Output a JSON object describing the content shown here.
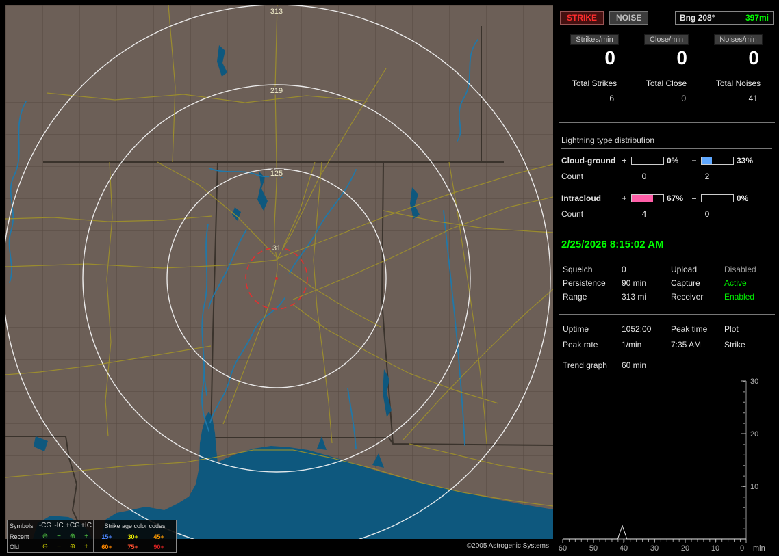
{
  "colors": {
    "accent_green": "#00ff00",
    "strike_red": "#ff2d2d",
    "bar_blue": "#5fa8ff",
    "bar_pink": "#ff5fa8",
    "map_land": "#6c5f57",
    "map_water": "#0e587e",
    "status_disabled": "#9a9a9a"
  },
  "map": {
    "rings": [
      {
        "label": "313"
      },
      {
        "label": "219"
      },
      {
        "label": "125"
      },
      {
        "label": "31"
      }
    ],
    "copyright": "©2005 Astrogenic Systems",
    "legend": {
      "symbols_header": "Symbols",
      "columns": [
        "-CG",
        "-IC",
        "+CG",
        "+IC"
      ],
      "age_header": "Strike age color codes",
      "rows": [
        {
          "label": "Recent",
          "symbols": [
            "⊖",
            "−",
            "⊕",
            "+"
          ],
          "ages": [
            "15+",
            "30+",
            "45+"
          ]
        },
        {
          "label": "Old",
          "symbols": [
            "⊖",
            "−",
            "⊕",
            "+"
          ],
          "ages": [
            "60+",
            "75+",
            "90+"
          ]
        }
      ]
    }
  },
  "panel": {
    "strike_button": "STRIKE",
    "noise_button": "NOISE",
    "bearing": {
      "label": "Bng 208°",
      "distance": "397mi"
    },
    "rates": [
      {
        "label": "Strikes/min",
        "value": "0"
      },
      {
        "label": "Close/min",
        "value": "0"
      },
      {
        "label": "Noises/min",
        "value": "0"
      }
    ],
    "totals": [
      {
        "label": "Total Strikes",
        "value": "6"
      },
      {
        "label": "Total Close",
        "value": "0"
      },
      {
        "label": "Total Noises",
        "value": "41"
      }
    ],
    "distribution": {
      "title": "Lightning type distribution",
      "rows": [
        {
          "label": "Cloud-ground",
          "plus_sign": "+",
          "plus_pct": "0%",
          "plus_fill": "0%",
          "minus_sign": "−",
          "minus_pct": "33%",
          "minus_fill": "33%",
          "count_label": "Count",
          "plus_count": "0",
          "minus_count": "2"
        },
        {
          "label": "Intracloud",
          "plus_sign": "+",
          "plus_pct": "67%",
          "plus_fill": "67%",
          "minus_sign": "−",
          "minus_pct": "0%",
          "minus_fill": "0%",
          "count_label": "Count",
          "plus_count": "4",
          "minus_count": "0"
        }
      ]
    },
    "datetime": "2/25/2026 8:15:02 AM",
    "settings": [
      {
        "label": "Squelch",
        "value": "0",
        "label2": "Upload",
        "value2": "Disabled",
        "status_class": "st-gray"
      },
      {
        "label": "Persistence",
        "value": "90 min",
        "label2": "Capture",
        "value2": "Active",
        "status_class": "st-green"
      },
      {
        "label": "Range",
        "value": "313 mi",
        "label2": "Receiver",
        "value2": "Enabled",
        "status_class": "st-green"
      }
    ],
    "stats": [
      {
        "label": "Uptime",
        "value": "1052:00",
        "col3": "Peak time",
        "col4": "Plot"
      },
      {
        "label": "Peak rate",
        "value": "1/min",
        "col3": "7:35 AM",
        "col4": "Strike"
      }
    ],
    "trend_label": "Trend graph",
    "trend_value": "60 min"
  },
  "chart_data": {
    "type": "line",
    "title": "Trend graph",
    "window": "60 min",
    "series": [
      {
        "name": "Strike",
        "x": [
          60,
          44,
          42,
          40.5,
          39,
          0
        ],
        "values": [
          0,
          0,
          0,
          2.5,
          0,
          0
        ]
      }
    ],
    "x_ticks": [
      "60",
      "50",
      "40",
      "30",
      "20",
      "10",
      "0"
    ],
    "y_ticks": [
      "30",
      "20",
      "10"
    ],
    "x_unit": "min",
    "xlim": [
      60,
      0
    ],
    "ylim": [
      0,
      30
    ],
    "grid": false,
    "legend_position": "none"
  }
}
